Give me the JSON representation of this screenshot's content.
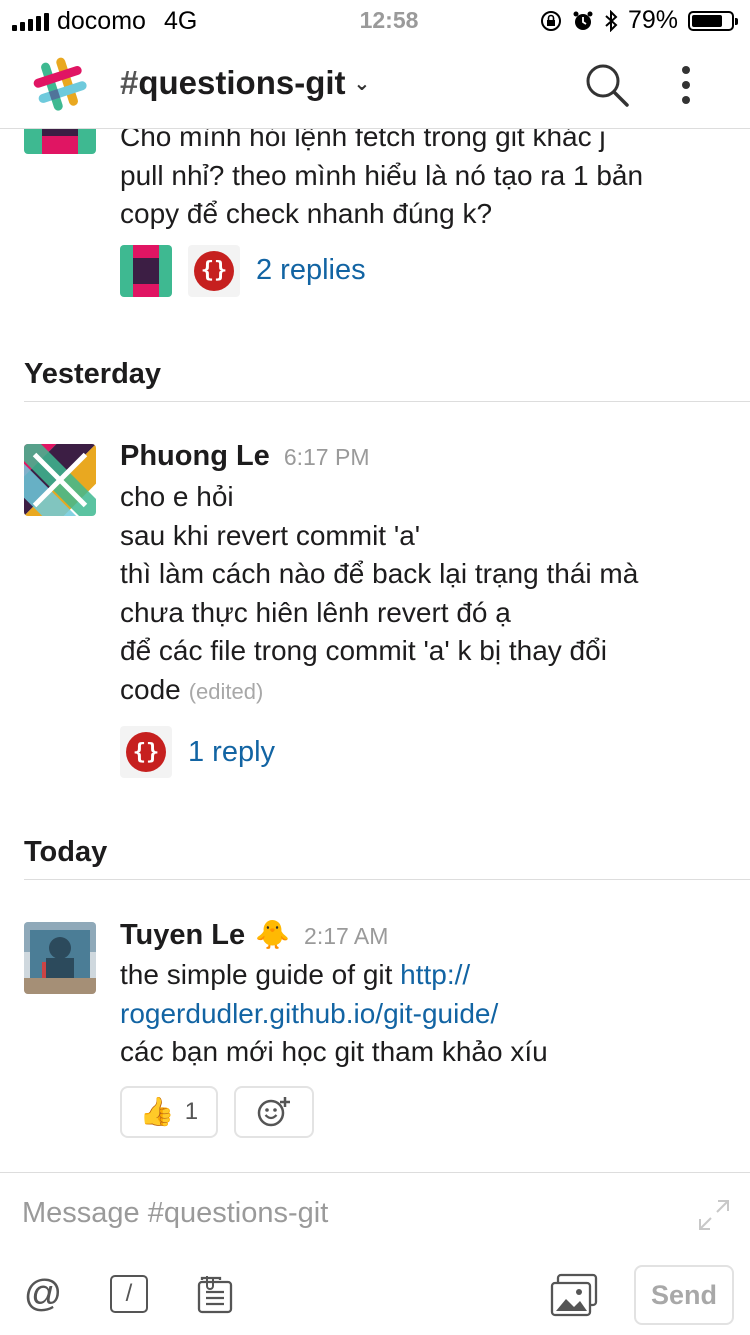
{
  "status_bar": {
    "carrier": "docomo",
    "network": "4G",
    "time": "12:58",
    "battery": "79%",
    "battery_level": 0.79
  },
  "header": {
    "hash": "#",
    "channel_name": "questions-git",
    "caret": "⌄"
  },
  "messages": [
    {
      "text_lines": [
        "Cho mình hỏi lệnh fetch trong git khác j",
        "pull nhỉ? theo mình hiểu là nó tạo ra 1 bản",
        "copy để check nhanh đúng k?"
      ],
      "replies": "2 replies"
    },
    {
      "author": "Phuong Le",
      "time": "6:17 PM",
      "text_lines": [
        "cho e hỏi",
        "sau khi revert commit 'a'",
        "thì làm cách nào để back lại trạng thái mà",
        "chưa thực hiên lênh revert đó ạ",
        "để các file trong commit 'a' k bị thay đổi",
        "code"
      ],
      "edited": "(edited)",
      "replies": "1 reply"
    },
    {
      "author": "Tuyen Le",
      "author_emoji": "🐥",
      "time": "2:17 AM",
      "text_prefix": "the simple guide of git ",
      "link_line1": "http://",
      "link_line2": "rogerdudler.github.io/git-guide/",
      "text_line3": "các bạn mới học git tham khảo xíu",
      "reaction_emoji": "👍",
      "reaction_count": "1"
    }
  ],
  "day_separators": {
    "yesterday": "Yesterday",
    "today": "Today"
  },
  "composer": {
    "placeholder": "Message #questions-git",
    "send_label": "Send",
    "at_symbol": "@",
    "slash_symbol": "/"
  },
  "colors": {
    "link": "#1264a3",
    "app_red": "#c6201f",
    "text": "#1d1c1d",
    "muted": "#9a9a9a"
  }
}
